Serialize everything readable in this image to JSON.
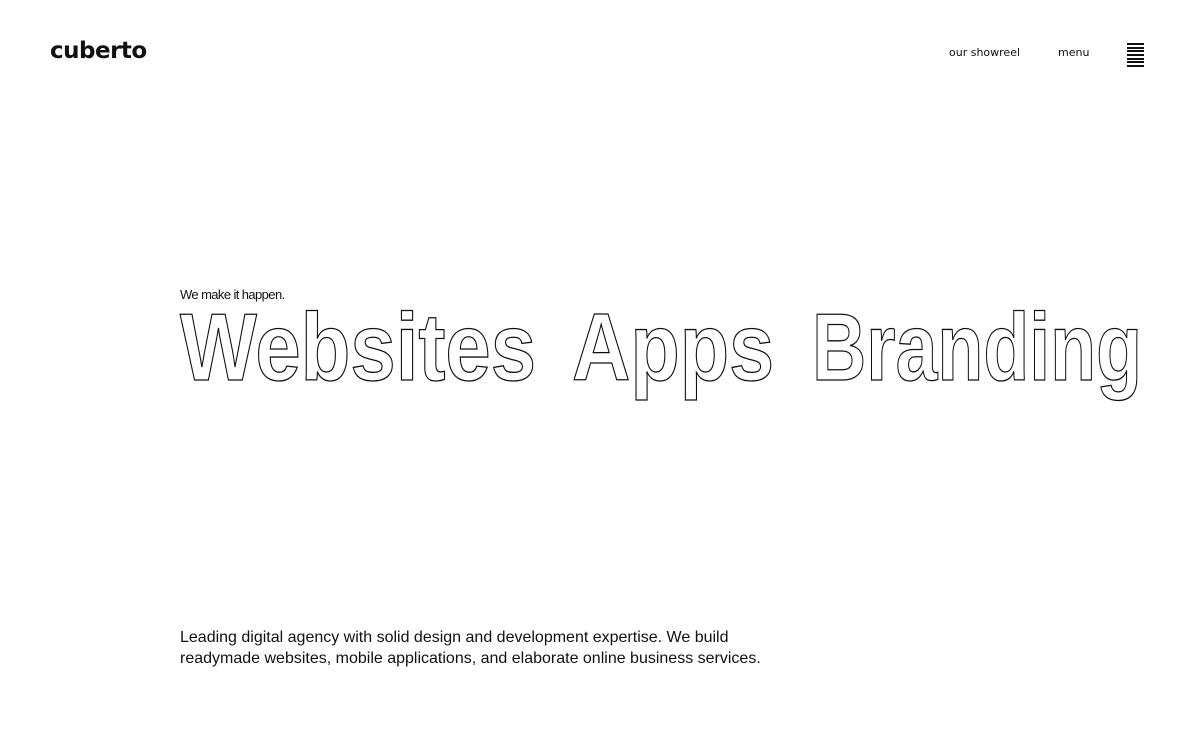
{
  "header": {
    "logo": "cuberto",
    "nav": {
      "showreel_label": "our showreel",
      "menu_label": "menu",
      "menu_icon": "hamburger-icon"
    }
  },
  "hero": {
    "tagline": "We make it happen.",
    "services": [
      "Websites",
      "Apps",
      "Branding"
    ],
    "description": "Leading digital agency with solid design and development expertise. We build readymade websites, mobile applications, and elaborate online business services."
  },
  "colors": {
    "background": "#ffffff",
    "text": "#111111"
  }
}
